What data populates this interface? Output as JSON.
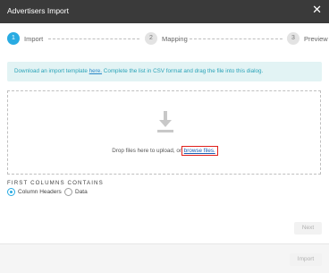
{
  "dialog": {
    "title": "Advertisers Import",
    "close_glyph": "✕"
  },
  "stepper": {
    "steps": [
      {
        "number": "1",
        "label": "Import"
      },
      {
        "number": "2",
        "label": "Mapping"
      },
      {
        "number": "3",
        "label": "Preview"
      }
    ],
    "active_step": 1
  },
  "info": {
    "prefix": "Download an import template ",
    "link": "here.",
    "suffix": " Complete the list in CSV format and drag the file into this dialog."
  },
  "dropzone": {
    "icon": "download-arrow-icon",
    "text_prefix": "Drop files here to upload, or ",
    "browse_link": "browse files."
  },
  "first_columns": {
    "label": "FIRST COLUMNS CONTAINS",
    "options": [
      {
        "label": "Column Headers",
        "selected": true
      },
      {
        "label": "Data",
        "selected": false
      }
    ]
  },
  "buttons": {
    "next": "Next",
    "import": "Import"
  },
  "colors": {
    "accent": "#29abe2",
    "titlebar": "#3a3a3a",
    "info_bg": "#e2f3f4",
    "highlight": "#e0201b"
  }
}
